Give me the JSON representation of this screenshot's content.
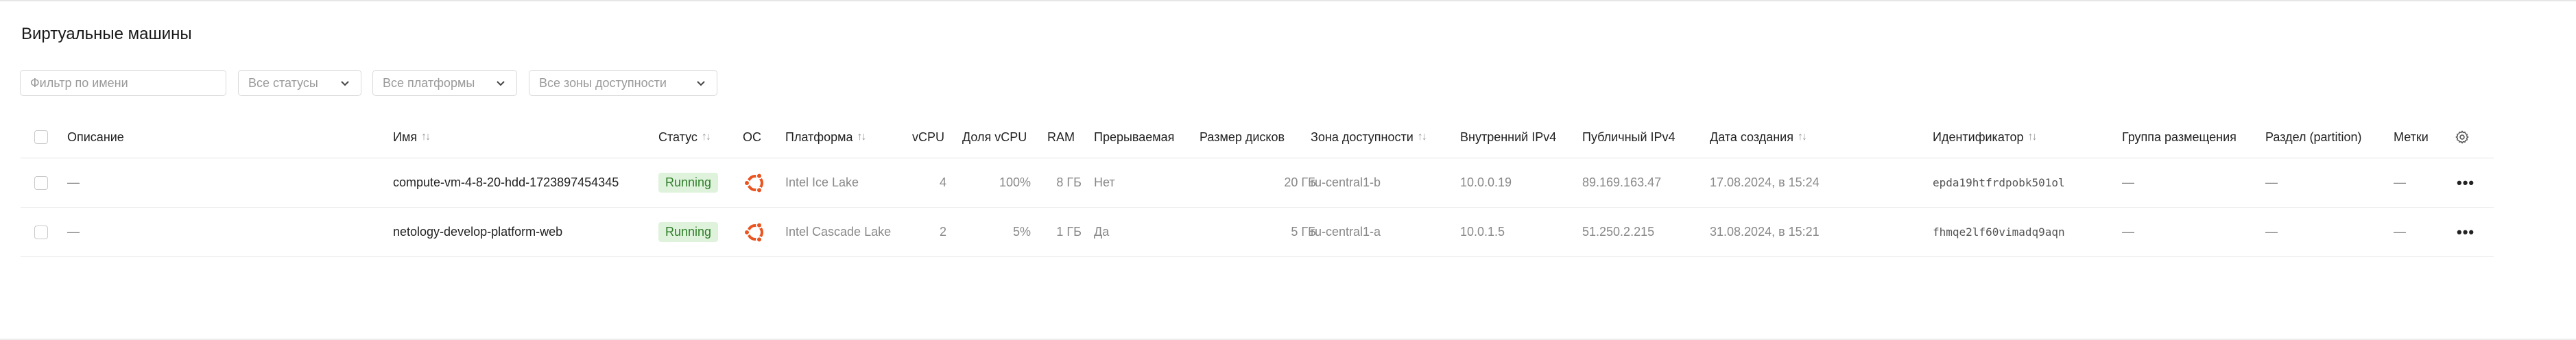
{
  "page": {
    "title": "Виртуальные машины"
  },
  "filters": {
    "name_placeholder": "Фильтр по имени",
    "status": "Все статусы",
    "platform": "Все платформы",
    "zone": "Все зоны доступности"
  },
  "colors": {
    "status_running_bg": "#dff3dc",
    "status_running_text": "#2f7d2a",
    "ubuntu_orange": "#e95420"
  },
  "table": {
    "columns": {
      "description": "Описание",
      "name": "Имя",
      "status": "Статус",
      "os": "ОС",
      "platform": "Платформа",
      "vcpu": "vCPU",
      "vcpu_share": "Доля vCPU",
      "ram": "RAM",
      "preemptible": "Прерываемая",
      "disk_size": "Размер дисков",
      "zone": "Зона доступности",
      "internal_ip": "Внутренний IPv4",
      "public_ip": "Публичный IPv4",
      "created": "Дата создания",
      "id": "Идентификатор",
      "placement_group": "Группа размещения",
      "partition": "Раздел (partition)",
      "labels": "Метки"
    },
    "sort_icon": "↑↓",
    "settings_icon": "gear-icon",
    "rows": [
      {
        "description": "—",
        "name": "compute-vm-4-8-20-hdd-1723897454345",
        "status": "Running",
        "os_icon": "ubuntu-icon",
        "platform": "Intel Ice Lake",
        "vcpu": "4",
        "vcpu_share": "100%",
        "ram": "8 ГБ",
        "preemptible": "Нет",
        "disk_size": "20 ГБ",
        "zone": "ru-central1-b",
        "internal_ip": "10.0.0.19",
        "public_ip": "89.169.163.47",
        "created": "17.08.2024, в 15:24",
        "id": "epda19htfrdpobk501ol",
        "placement_group": "—",
        "partition": "—",
        "labels": "—",
        "actions": "•••"
      },
      {
        "description": "—",
        "name": "netology-develop-platform-web",
        "status": "Running",
        "os_icon": "ubuntu-icon",
        "platform": "Intel Cascade Lake",
        "vcpu": "2",
        "vcpu_share": "5%",
        "ram": "1 ГБ",
        "preemptible": "Да",
        "disk_size": "5 ГБ",
        "zone": "ru-central1-a",
        "internal_ip": "10.0.1.5",
        "public_ip": "51.250.2.215",
        "created": "31.08.2024, в 15:21",
        "id": "fhmqe2lf60vimadq9aqn",
        "placement_group": "—",
        "partition": "—",
        "labels": "—",
        "actions": "•••"
      }
    ]
  }
}
